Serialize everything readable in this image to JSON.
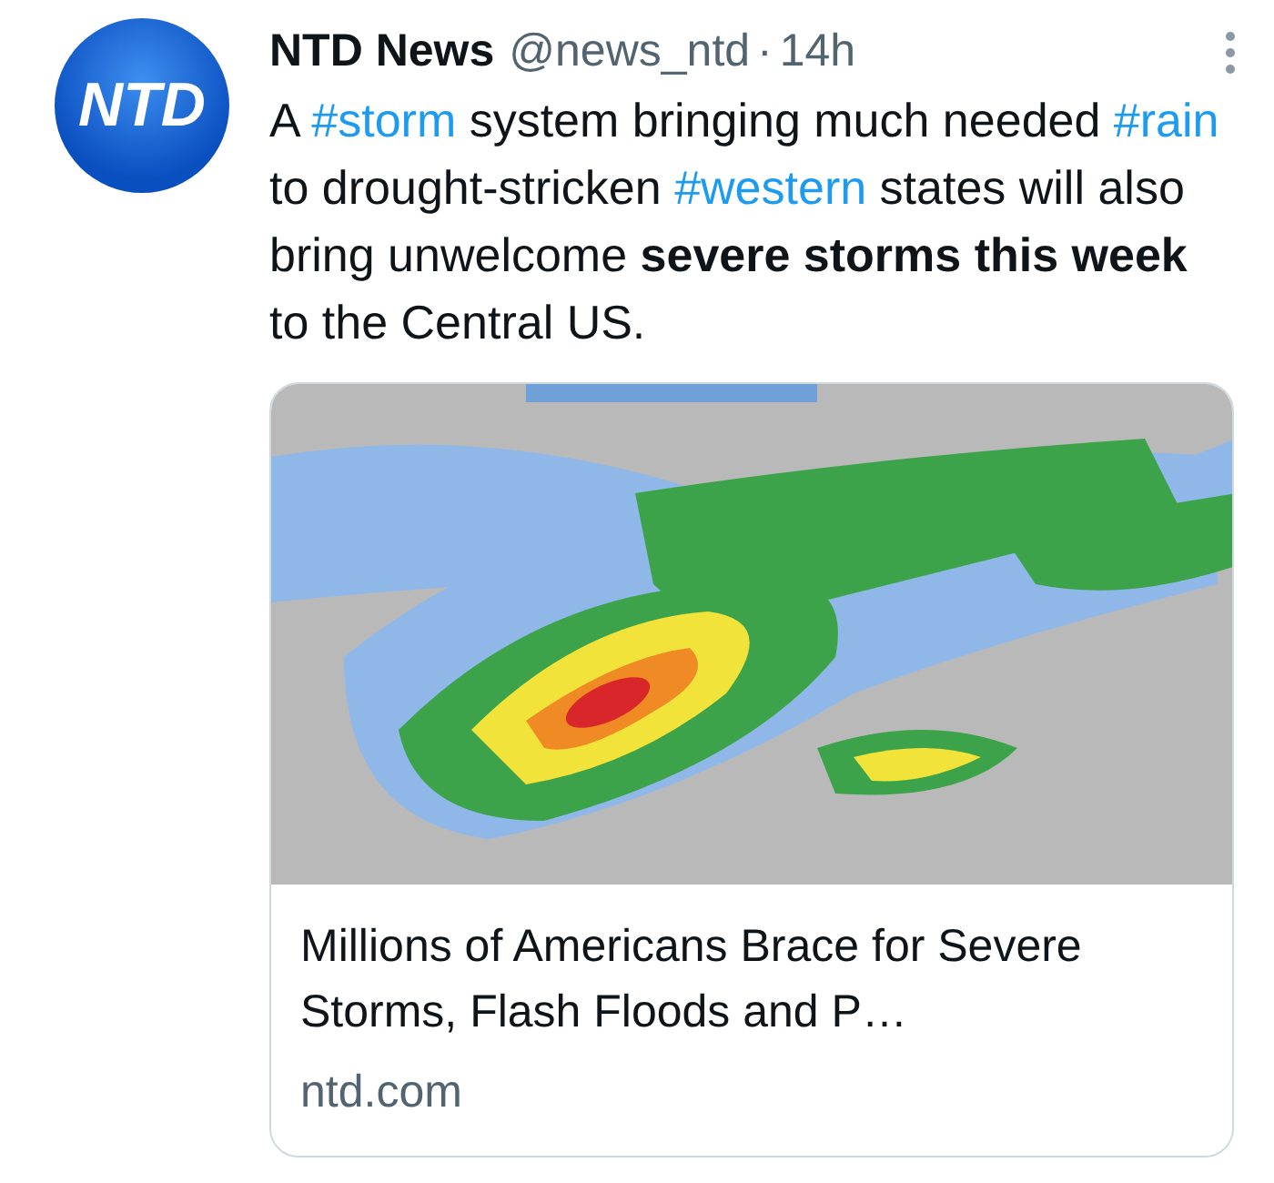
{
  "avatar": {
    "logo_text": "NTD"
  },
  "header": {
    "name": "NTD News",
    "handle": "@news_ntd",
    "separator": "·",
    "time": "14h"
  },
  "tweet_text": [
    {
      "kind": "plain",
      "text": "A "
    },
    {
      "kind": "hashtag",
      "text": "#storm"
    },
    {
      "kind": "plain",
      "text": " system bringing much needed "
    },
    {
      "kind": "hashtag",
      "text": "#rain"
    },
    {
      "kind": "plain",
      "text": " to drought-stricken "
    },
    {
      "kind": "hashtag",
      "text": "#western"
    },
    {
      "kind": "plain",
      "text": " states will also bring unwelcome "
    },
    {
      "kind": "bold",
      "text": "severe storms this week"
    },
    {
      "kind": "plain",
      "text": " to the Central US."
    }
  ],
  "link_card": {
    "title": "Millions of Americans Brace for Severe Storms, Flash Floods and P…",
    "domain": "ntd.com"
  }
}
